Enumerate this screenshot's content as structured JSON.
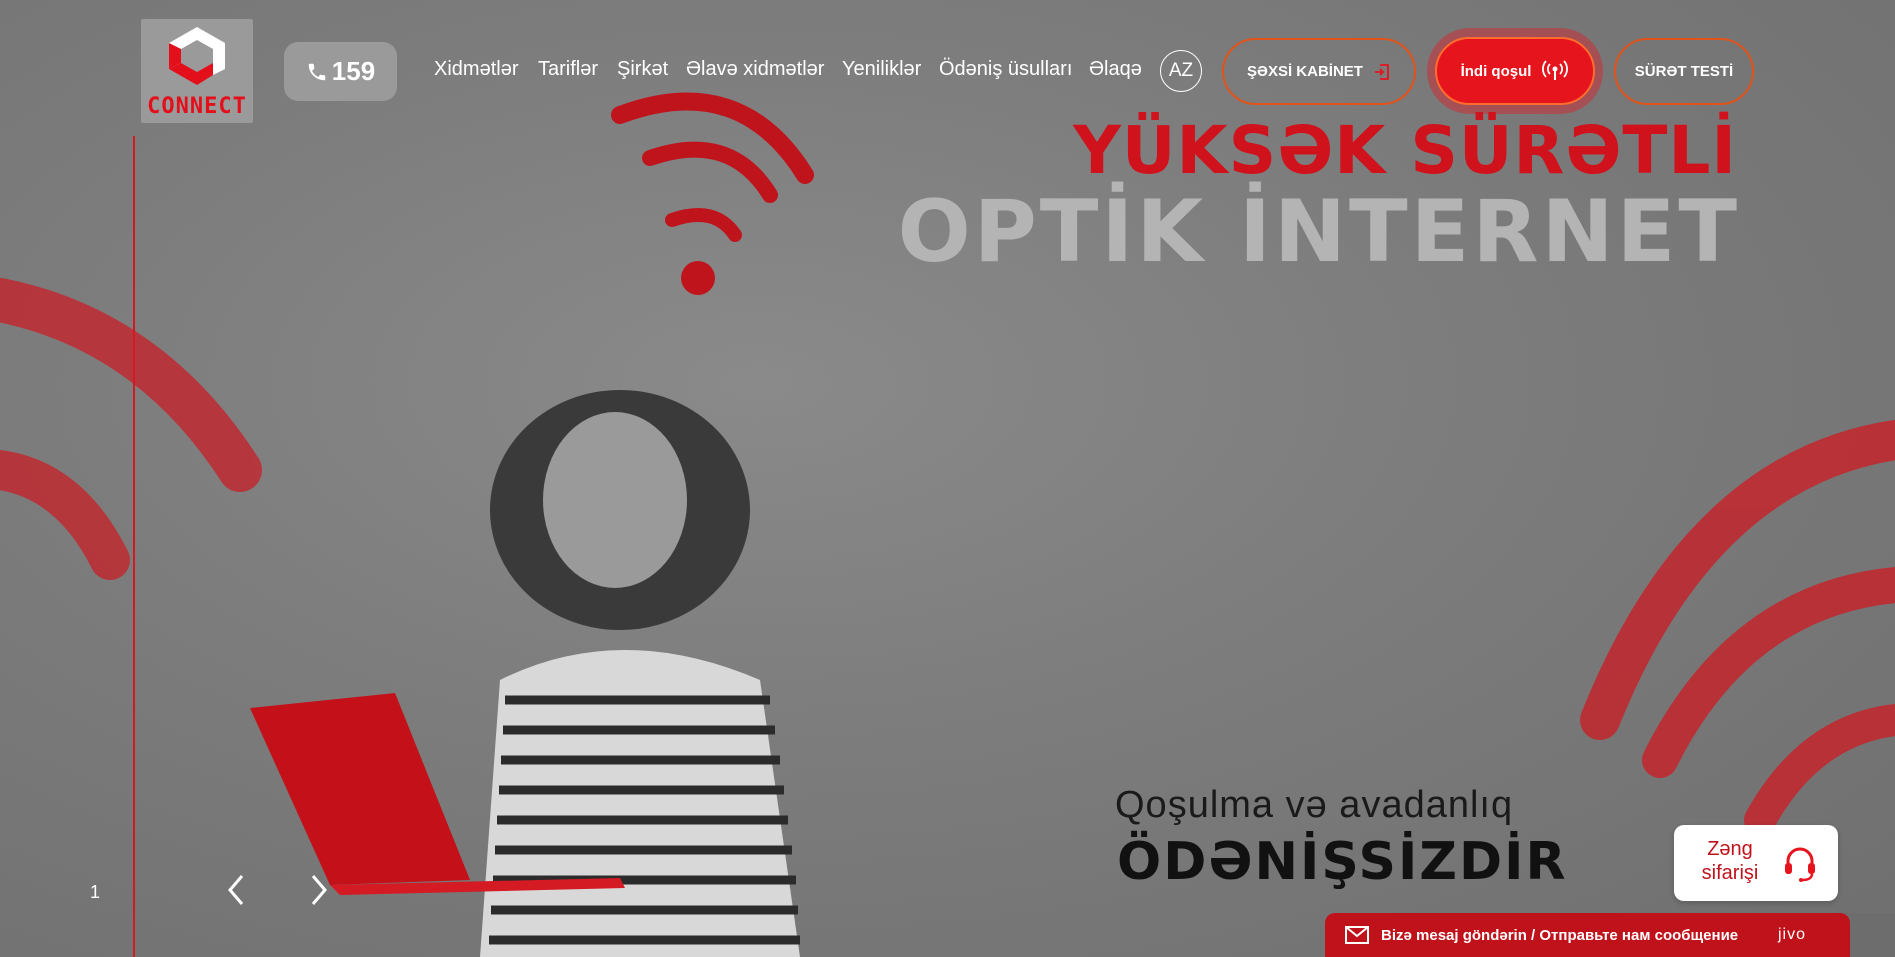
{
  "brand": {
    "logo_text": "CONNECT",
    "accent": "#e5141d"
  },
  "header": {
    "phone": "159",
    "nav": [
      {
        "label": "Xidmətlər"
      },
      {
        "label": "Tariflər"
      },
      {
        "label": "Şirkət"
      },
      {
        "label": "Əlavə xidmətlər"
      },
      {
        "label": "Yeniliklər"
      },
      {
        "label": "Ödəniş üsulları"
      },
      {
        "label": "Əlaqə"
      }
    ],
    "language": "AZ",
    "cabinet_label": "ŞƏXSİ KABİNET",
    "connect_label": "İndi qoşul",
    "speed_test_label": "SÜRƏT TESTİ"
  },
  "hero": {
    "headline_1": "YÜKSƏK SÜRƏTLİ",
    "headline_2": "OPTİK İNTERNET",
    "sub_1": "Qoşulma və avadanlıq",
    "sub_2": "ÖDƏNİŞSİZDİR",
    "slide_number": "1"
  },
  "widgets": {
    "call_order": "Zəng sifarişi",
    "chat_label": "Bizə mesaj göndərin / Отправьте нам сообщение",
    "chat_brand": "jivo"
  }
}
